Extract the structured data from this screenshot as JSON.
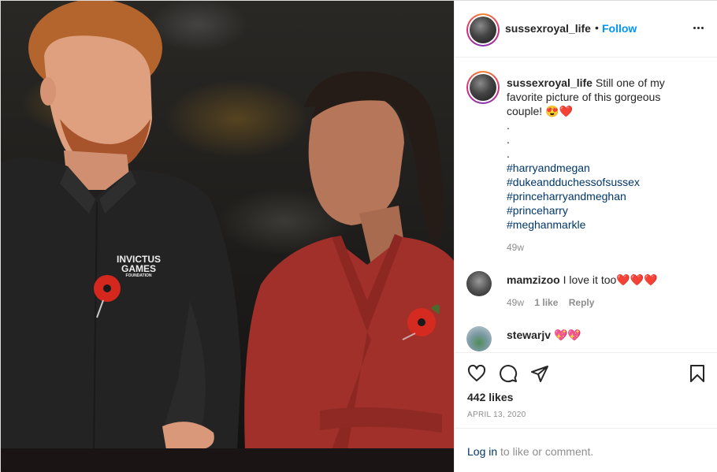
{
  "post": {
    "username": "sussexroyal_life",
    "separator": "•",
    "follow_label": "Follow",
    "more_icon": "more-horizontal-icon"
  },
  "photo": {
    "badge_line1": "INVICTUS",
    "badge_line2": "GAMES",
    "badge_line3": "FOUNDATION"
  },
  "caption": {
    "username": "sussexroyal_life",
    "text": "Still one of my favorite picture of this gorgeous couple! 😍❤️",
    "dots": [
      ".",
      ".",
      "."
    ],
    "hashtags": [
      "#harryandmegan",
      "#dukeandduchessofsussex",
      "#princeharryandmeghan",
      "#princeharry",
      "#meghanmarkle"
    ],
    "time": "49w"
  },
  "comments": [
    {
      "username": "mamzizoo",
      "text": "I love it too❤️❤️❤️",
      "time": "49w",
      "likes": "1 like",
      "reply": "Reply"
    },
    {
      "username": "stewarjv",
      "text": "💖💖"
    }
  ],
  "actions": {
    "icons": [
      "heart-icon",
      "comment-icon",
      "share-icon",
      "bookmark-icon"
    ],
    "likes": "442 likes",
    "date": "APRIL 13, 2020"
  },
  "footer": {
    "login_link": "Log in",
    "login_suffix": " to like or comment."
  },
  "colors": {
    "accent": "#0095f6",
    "hashtag": "#00376b",
    "muted": "#8e8e8e",
    "text": "#262626"
  }
}
